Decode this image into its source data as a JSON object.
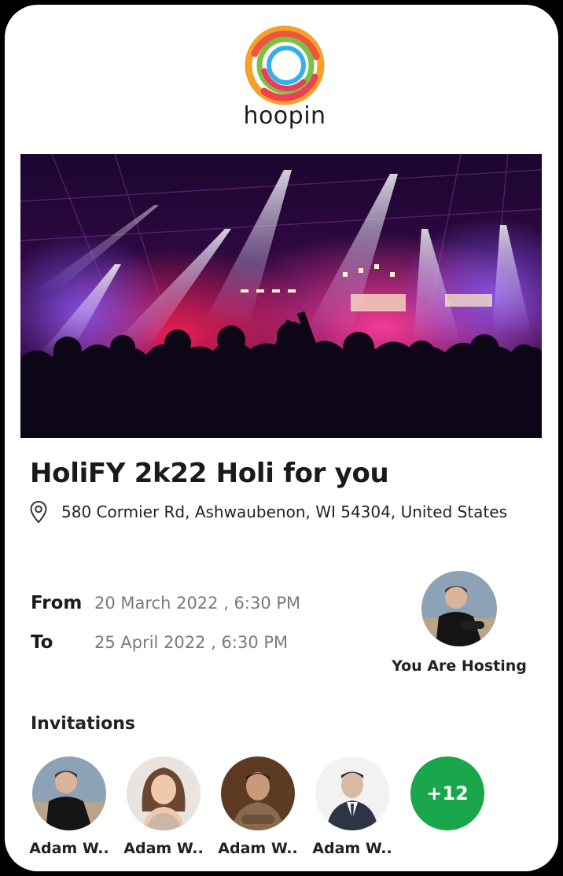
{
  "brand": {
    "name": "hoopin",
    "logo_icon": "hoopin-swirl-logo"
  },
  "event": {
    "title": "HoliFY 2k22 Holi for you",
    "location": "580 Cormier Rd, Ashwaubenon, WI 54304, United States",
    "from_label": "From",
    "from_value": "20 March 2022 , 6:30 PM",
    "to_label": "To",
    "to_value": "25 April 2022 , 6:30 PM"
  },
  "host": {
    "label": "You Are Hosting"
  },
  "invitations": {
    "title": "Invitations",
    "people": [
      {
        "name": "Adam W.."
      },
      {
        "name": "Adam W.."
      },
      {
        "name": "Adam W.."
      },
      {
        "name": "Adam W.."
      }
    ],
    "more_count": "+12"
  },
  "colors": {
    "accent_green": "#1aa64b",
    "text_dark": "#1a1a1a",
    "text_muted": "#7a7a7a"
  }
}
